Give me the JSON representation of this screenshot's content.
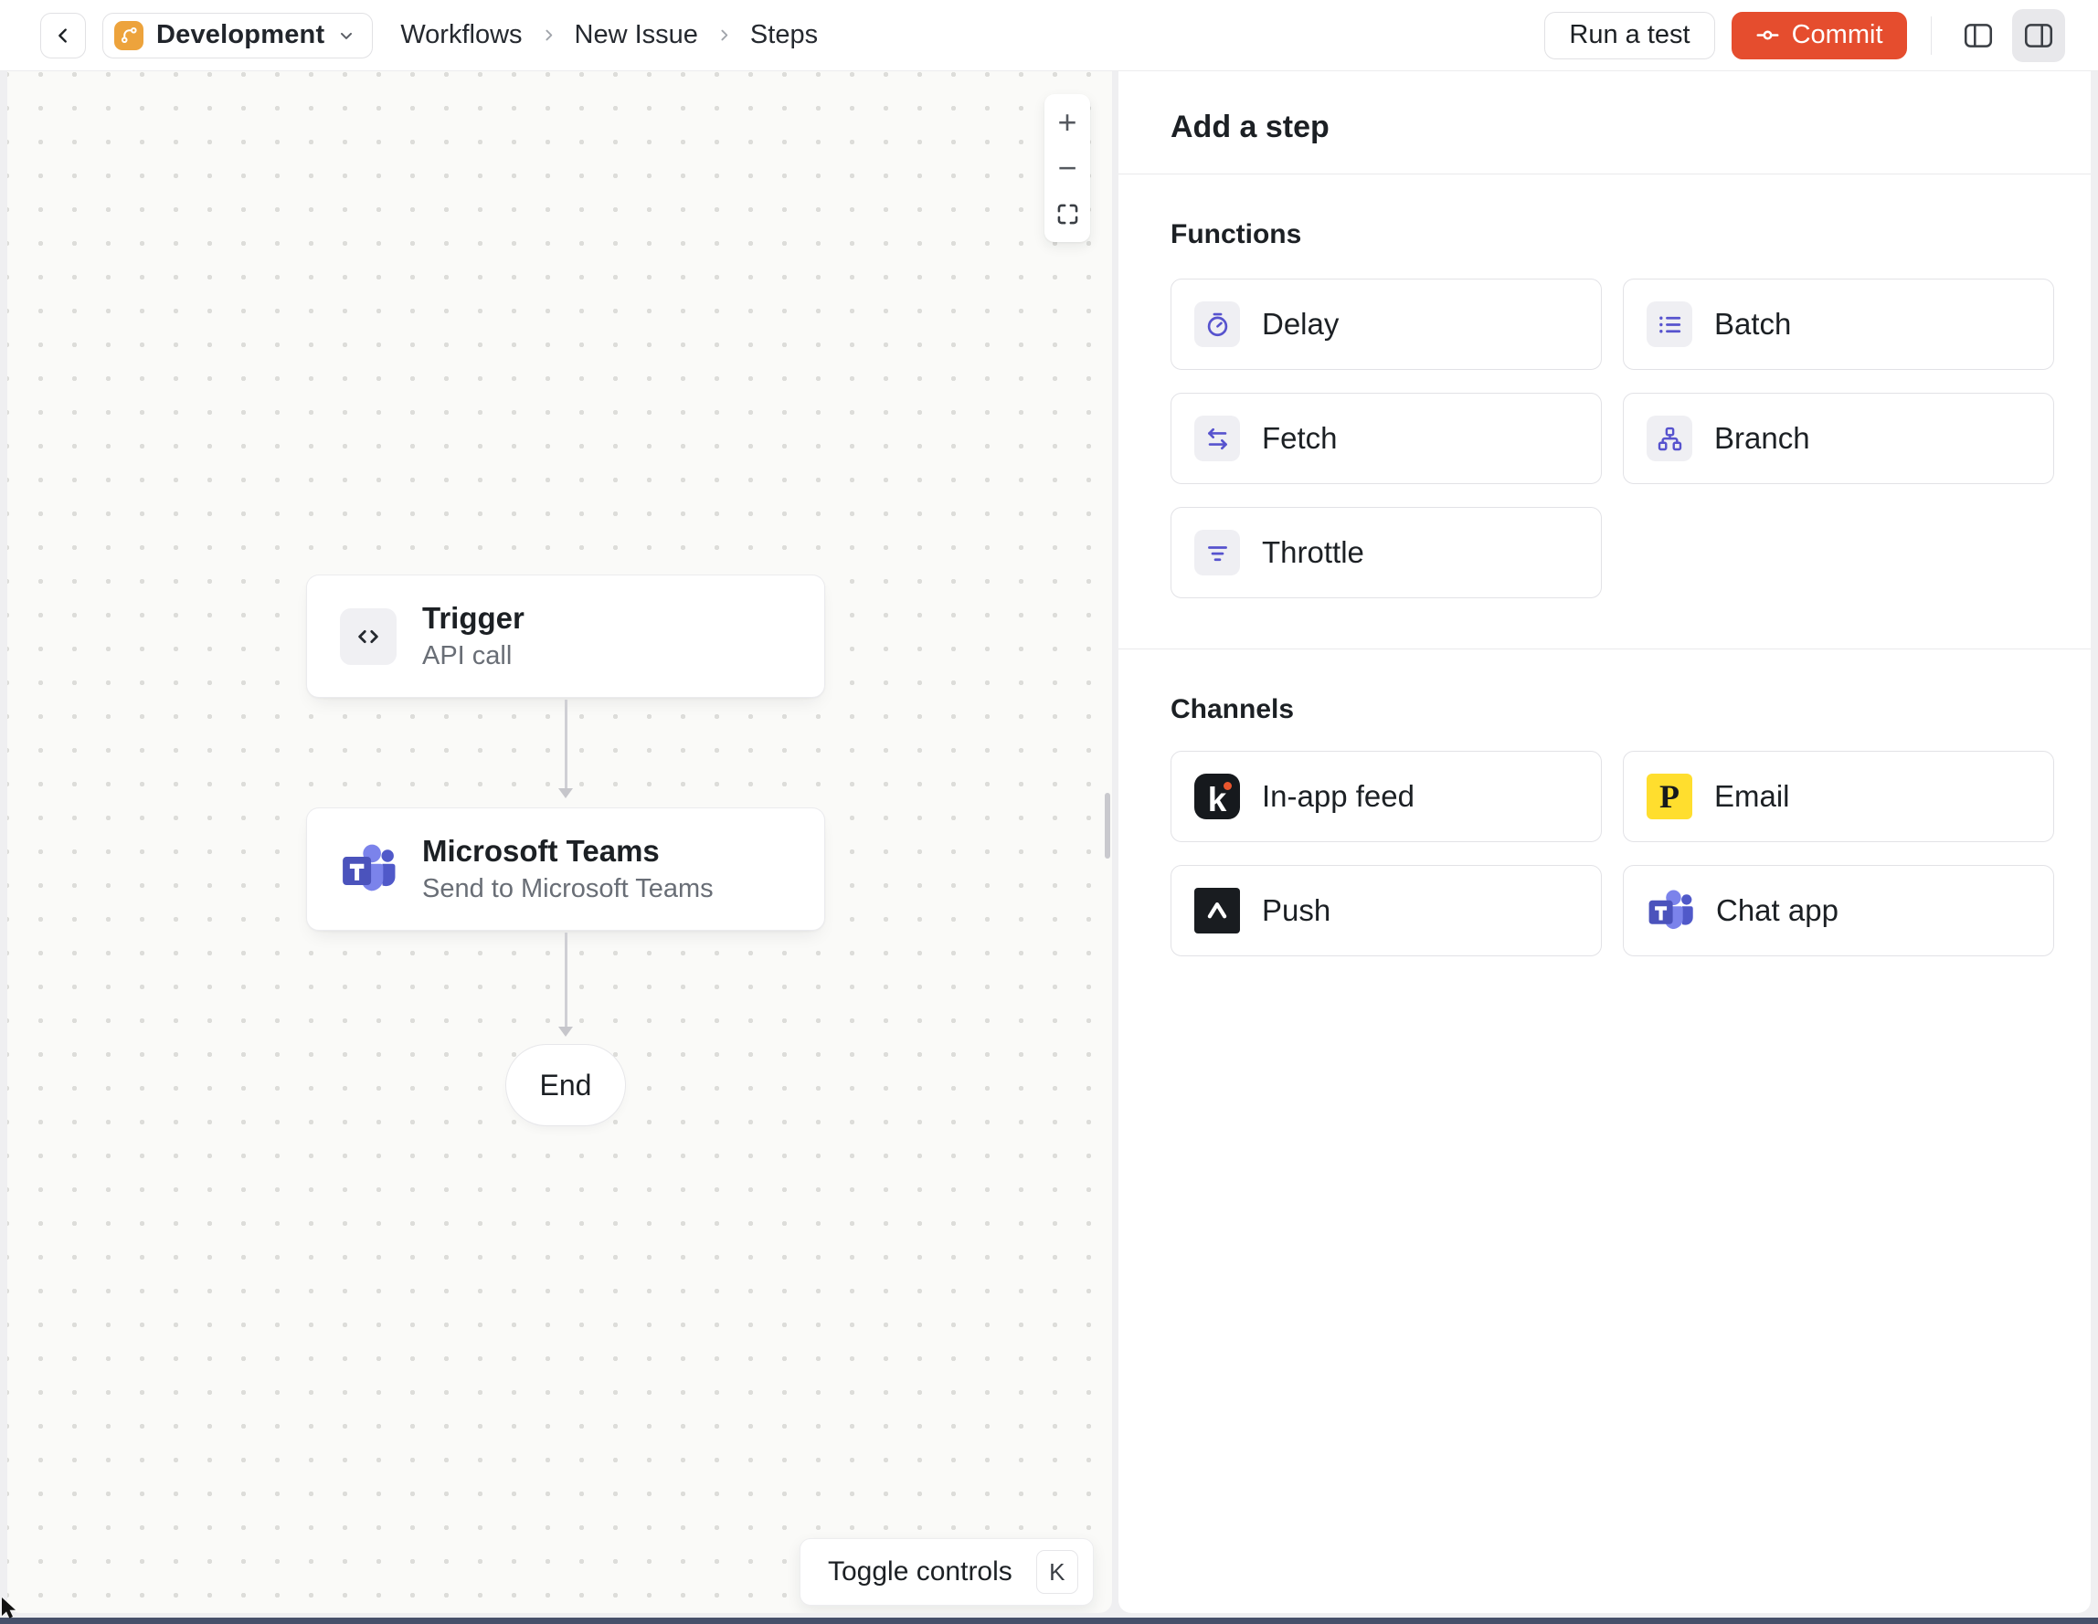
{
  "header": {
    "environment": "Development",
    "breadcrumbs": [
      "Workflows",
      "New Issue",
      "Steps"
    ],
    "run_a_test": "Run a test",
    "commit": "Commit"
  },
  "canvas": {
    "zoom_in": "+",
    "zoom_out": "−",
    "trigger": {
      "title": "Trigger",
      "subtitle": "API call"
    },
    "teams": {
      "title": "Microsoft Teams",
      "subtitle": "Send to Microsoft Teams"
    },
    "end": "End",
    "toggle_controls": "Toggle controls",
    "toggle_shortcut": "K"
  },
  "panel": {
    "title": "Add a step",
    "functions_heading": "Functions",
    "functions": [
      {
        "label": "Delay",
        "icon": "stopwatch-icon"
      },
      {
        "label": "Batch",
        "icon": "list-icon"
      },
      {
        "label": "Fetch",
        "icon": "swap-arrows-icon"
      },
      {
        "label": "Branch",
        "icon": "hierarchy-icon"
      },
      {
        "label": "Throttle",
        "icon": "funnel-icon"
      }
    ],
    "channels_heading": "Channels",
    "channels": [
      {
        "label": "In-app feed",
        "icon": "knock-logo"
      },
      {
        "label": "Email",
        "icon": "postmark-logo"
      },
      {
        "label": "Push",
        "icon": "expo-logo"
      },
      {
        "label": "Chat app",
        "icon": "teams-logo"
      }
    ]
  },
  "colors": {
    "accent": "#E54D2E",
    "function_icon": "#5753CE",
    "environment_badge": "#EDA33C",
    "postmark_yellow": "#FFDE2E",
    "teams_purple": "#4B53BC"
  }
}
